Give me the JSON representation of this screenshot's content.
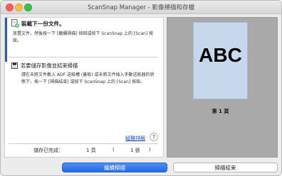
{
  "window": {
    "title": "ScanSnap Manager - 影像掃描和存檔"
  },
  "step": {
    "title": "裝載下一份文件。",
    "desc": "放置文件，然後按一下 [繼續掃描] 按鈕或按下 ScanSnap 上的 [Scan] 按鈕。"
  },
  "save": {
    "title": "若要儲存影像並結束掃描",
    "desc": "請在未將文件載入 ADF 送紙槽 (蓋板) 或未將文件插入手動送紙器的狀態下，按一下 [掃描結束] 或按下 ScanSnap 上的 [Scan] 按鈕。"
  },
  "help": {
    "link": "疑難排解",
    "button": "?"
  },
  "status": {
    "label": "儲存已完成：",
    "pages": "1 頁",
    "open_paren": "(",
    "sheets": "1 張",
    "close_paren": ")"
  },
  "preview": {
    "text": "ABC",
    "label": "第 1 頁"
  },
  "buttons": {
    "continue": "繼續掃描",
    "finish": "掃描結束"
  },
  "colors": {
    "accent": "#1c5ec9",
    "primary_button": "#2f74ec",
    "page": "#c7d7ec"
  }
}
